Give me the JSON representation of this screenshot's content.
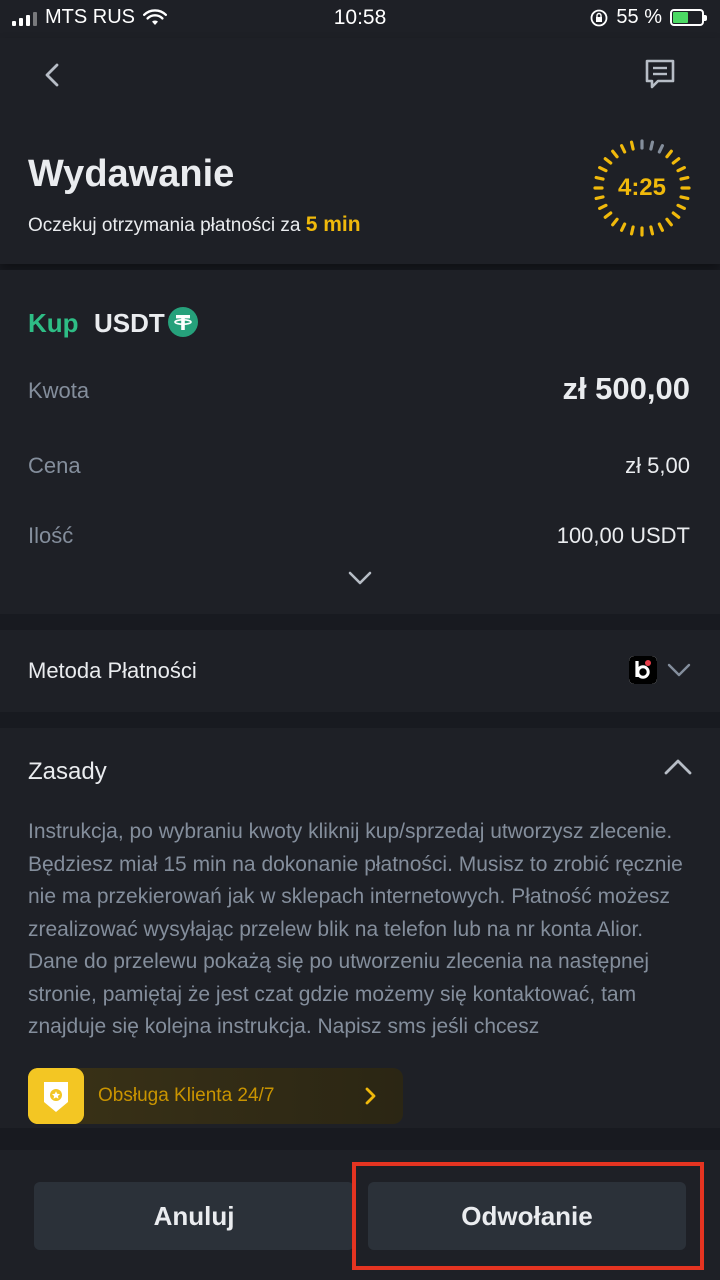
{
  "status_bar": {
    "carrier": "MTS RUS",
    "time": "10:58",
    "battery_percent": "55 %",
    "battery_level": 0.55
  },
  "header": {
    "title": "Wydawanie",
    "subtitle_prefix": "Oczekuj otrzymania płatności za",
    "subtitle_highlight": "5 min",
    "timer": "4:25"
  },
  "order": {
    "side": "Kup",
    "asset": "USDT",
    "rows": [
      {
        "label": "Kwota",
        "value": "zł 500,00"
      },
      {
        "label": "Cena",
        "value": "zł 5,00"
      },
      {
        "label": "Ilość",
        "value": "100,00 USDT"
      }
    ]
  },
  "payment": {
    "label": "Metoda Płatności",
    "method_icon": "blik-icon"
  },
  "rules": {
    "title": "Zasady",
    "text": "Instrukcja, po wybraniu kwoty kliknij kup/sprzedaj utworzysz zlecenie. Będziesz miał 15 min na dokonanie płatności. Musisz to zrobić ręcznie nie ma przekierowań jak w sklepach internetowych. Płatność możesz zrealizować wysyłając przelew blik na telefon lub na nr konta Alior. Dane do przelewu pokażą się po utworzeniu zlecenia na następnej stronie, pamiętaj że jest czat gdzie możemy się kontaktować, tam znajduje się kolejna instrukcja. Napisz sms jeśli chcesz"
  },
  "support": {
    "label": "Obsługa Klienta 24/7"
  },
  "footer": {
    "cancel_label": "Anuluj",
    "appeal_label": "Odwołanie"
  },
  "colors": {
    "accent": "#f0b90b",
    "buy": "#2ebd85",
    "background": "#181a20",
    "card": "#1e2026",
    "muted_text": "#848e9c",
    "highlight_box": "#e53421"
  }
}
